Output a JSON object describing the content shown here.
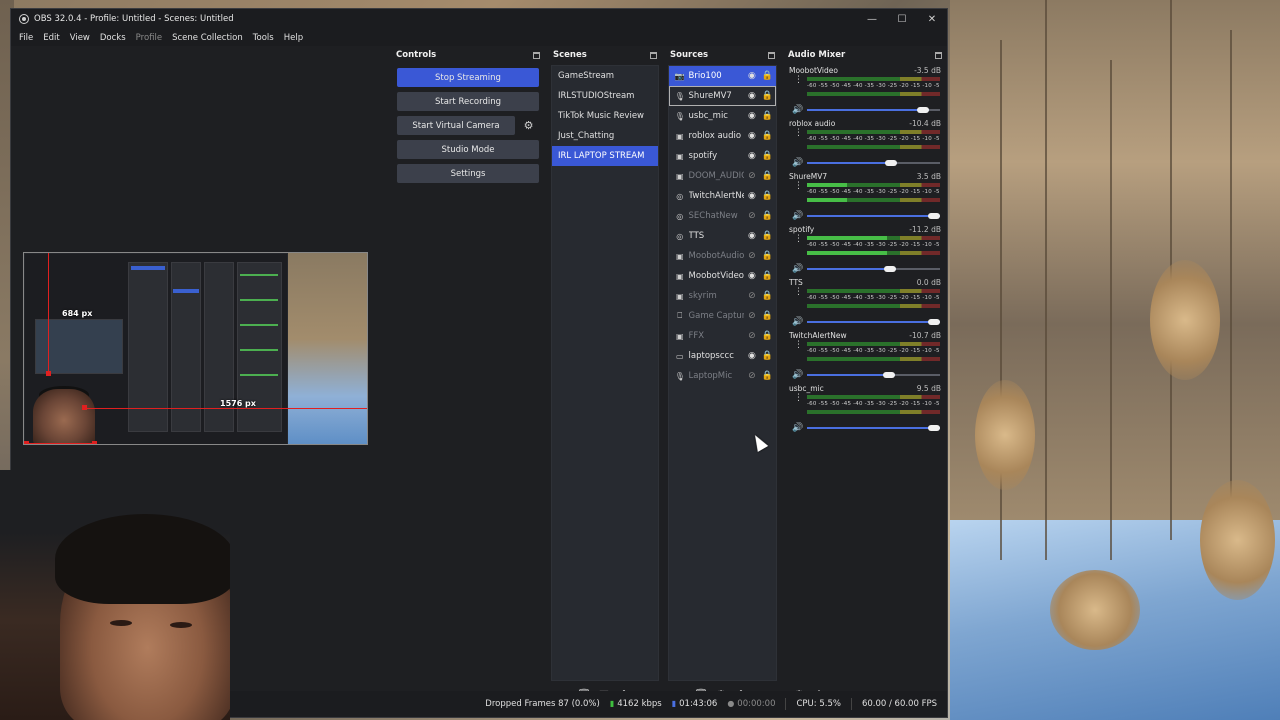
{
  "window": {
    "title": "OBS 32.0.4 - Profile: Untitled - Scenes: Untitled"
  },
  "menu": [
    "File",
    "Edit",
    "View",
    "Docks",
    "Profile",
    "Scene Collection",
    "Tools",
    "Help"
  ],
  "preview": {
    "guide_vertical": "684 px",
    "guide_horizontal": "1576 px"
  },
  "controls": {
    "title": "Controls",
    "stop_streaming": "Stop Streaming",
    "start_recording": "Start Recording",
    "start_virtual_camera": "Start Virtual Camera",
    "studio_mode": "Studio Mode",
    "settings": "Settings"
  },
  "scenes": {
    "title": "Scenes",
    "items": [
      "GameStream",
      "IRLSTUDIOStream",
      "TikTok Music Review",
      "Just_Chatting",
      "IRL LAPTOP STREAM"
    ],
    "selected_index": 4
  },
  "sources": {
    "title": "Sources",
    "items": [
      {
        "label": "Brio100",
        "icon": "camera-icon",
        "visible": true,
        "locked": false
      },
      {
        "label": "ShureMV7",
        "icon": "mic-icon",
        "visible": true,
        "locked": false
      },
      {
        "label": "usbc_mic",
        "icon": "mic-icon",
        "visible": true,
        "locked": false
      },
      {
        "label": "roblox audio",
        "icon": "window-icon",
        "visible": true,
        "locked": false
      },
      {
        "label": "spotify",
        "icon": "window-icon",
        "visible": true,
        "locked": false
      },
      {
        "label": "DOOM_AUDIO",
        "icon": "window-icon",
        "visible": false,
        "locked": true
      },
      {
        "label": "TwitchAlertNew",
        "icon": "globe-icon",
        "visible": true,
        "locked": true
      },
      {
        "label": "SEChatNew",
        "icon": "globe-icon",
        "visible": false,
        "locked": true
      },
      {
        "label": "TTS",
        "icon": "globe-icon",
        "visible": true,
        "locked": true
      },
      {
        "label": "MoobotAudio",
        "icon": "window-icon",
        "visible": false,
        "locked": true
      },
      {
        "label": "MoobotVideo",
        "icon": "window-icon",
        "visible": true,
        "locked": true
      },
      {
        "label": "skyrim",
        "icon": "window-icon",
        "visible": false,
        "locked": true
      },
      {
        "label": "Game Capture",
        "icon": "gamepad-icon",
        "visible": false,
        "locked": true
      },
      {
        "label": "FFX",
        "icon": "window-icon",
        "visible": false,
        "locked": true
      },
      {
        "label": "laptopsccc",
        "icon": "monitor-icon",
        "visible": true,
        "locked": true
      },
      {
        "label": "LaptopMic",
        "icon": "mic-icon",
        "visible": false,
        "locked": true
      }
    ]
  },
  "mixer": {
    "title": "Audio Mixer",
    "ticks": "-60 -55 -50 -45 -40 -35 -30 -25 -20 -15 -10 -5 0",
    "channels": [
      {
        "name": "MoobotVideo",
        "db": "-3.5 dB",
        "level": 0.0,
        "volume": 0.92
      },
      {
        "name": "roblox audio",
        "db": "-10.4 dB",
        "level": 0.0,
        "volume": 0.68
      },
      {
        "name": "ShureMV7",
        "db": "3.5 dB",
        "level": 0.3,
        "volume": 1.0
      },
      {
        "name": "spotify",
        "db": "-11.2 dB",
        "level": 0.6,
        "volume": 0.67
      },
      {
        "name": "TTS",
        "db": "0.0 dB",
        "level": 0.0,
        "volume": 1.0
      },
      {
        "name": "TwitchAlertNew",
        "db": "-10.7 dB",
        "level": 0.0,
        "volume": 0.66
      },
      {
        "name": "usbc_mic",
        "db": "9.5 dB",
        "level": 0.0,
        "volume": 1.0
      }
    ]
  },
  "status": {
    "dropped_frames": "Dropped Frames 87 (0.0%)",
    "bitrate": "4162 kbps",
    "stream_time": "01:43:06",
    "record_time": "00:00:00",
    "cpu": "CPU: 5.5%",
    "fps": "60.00 / 60.00 FPS"
  },
  "colors": {
    "accent": "#3a58d6",
    "panel": "#272a30",
    "background": "#1e1f22"
  }
}
